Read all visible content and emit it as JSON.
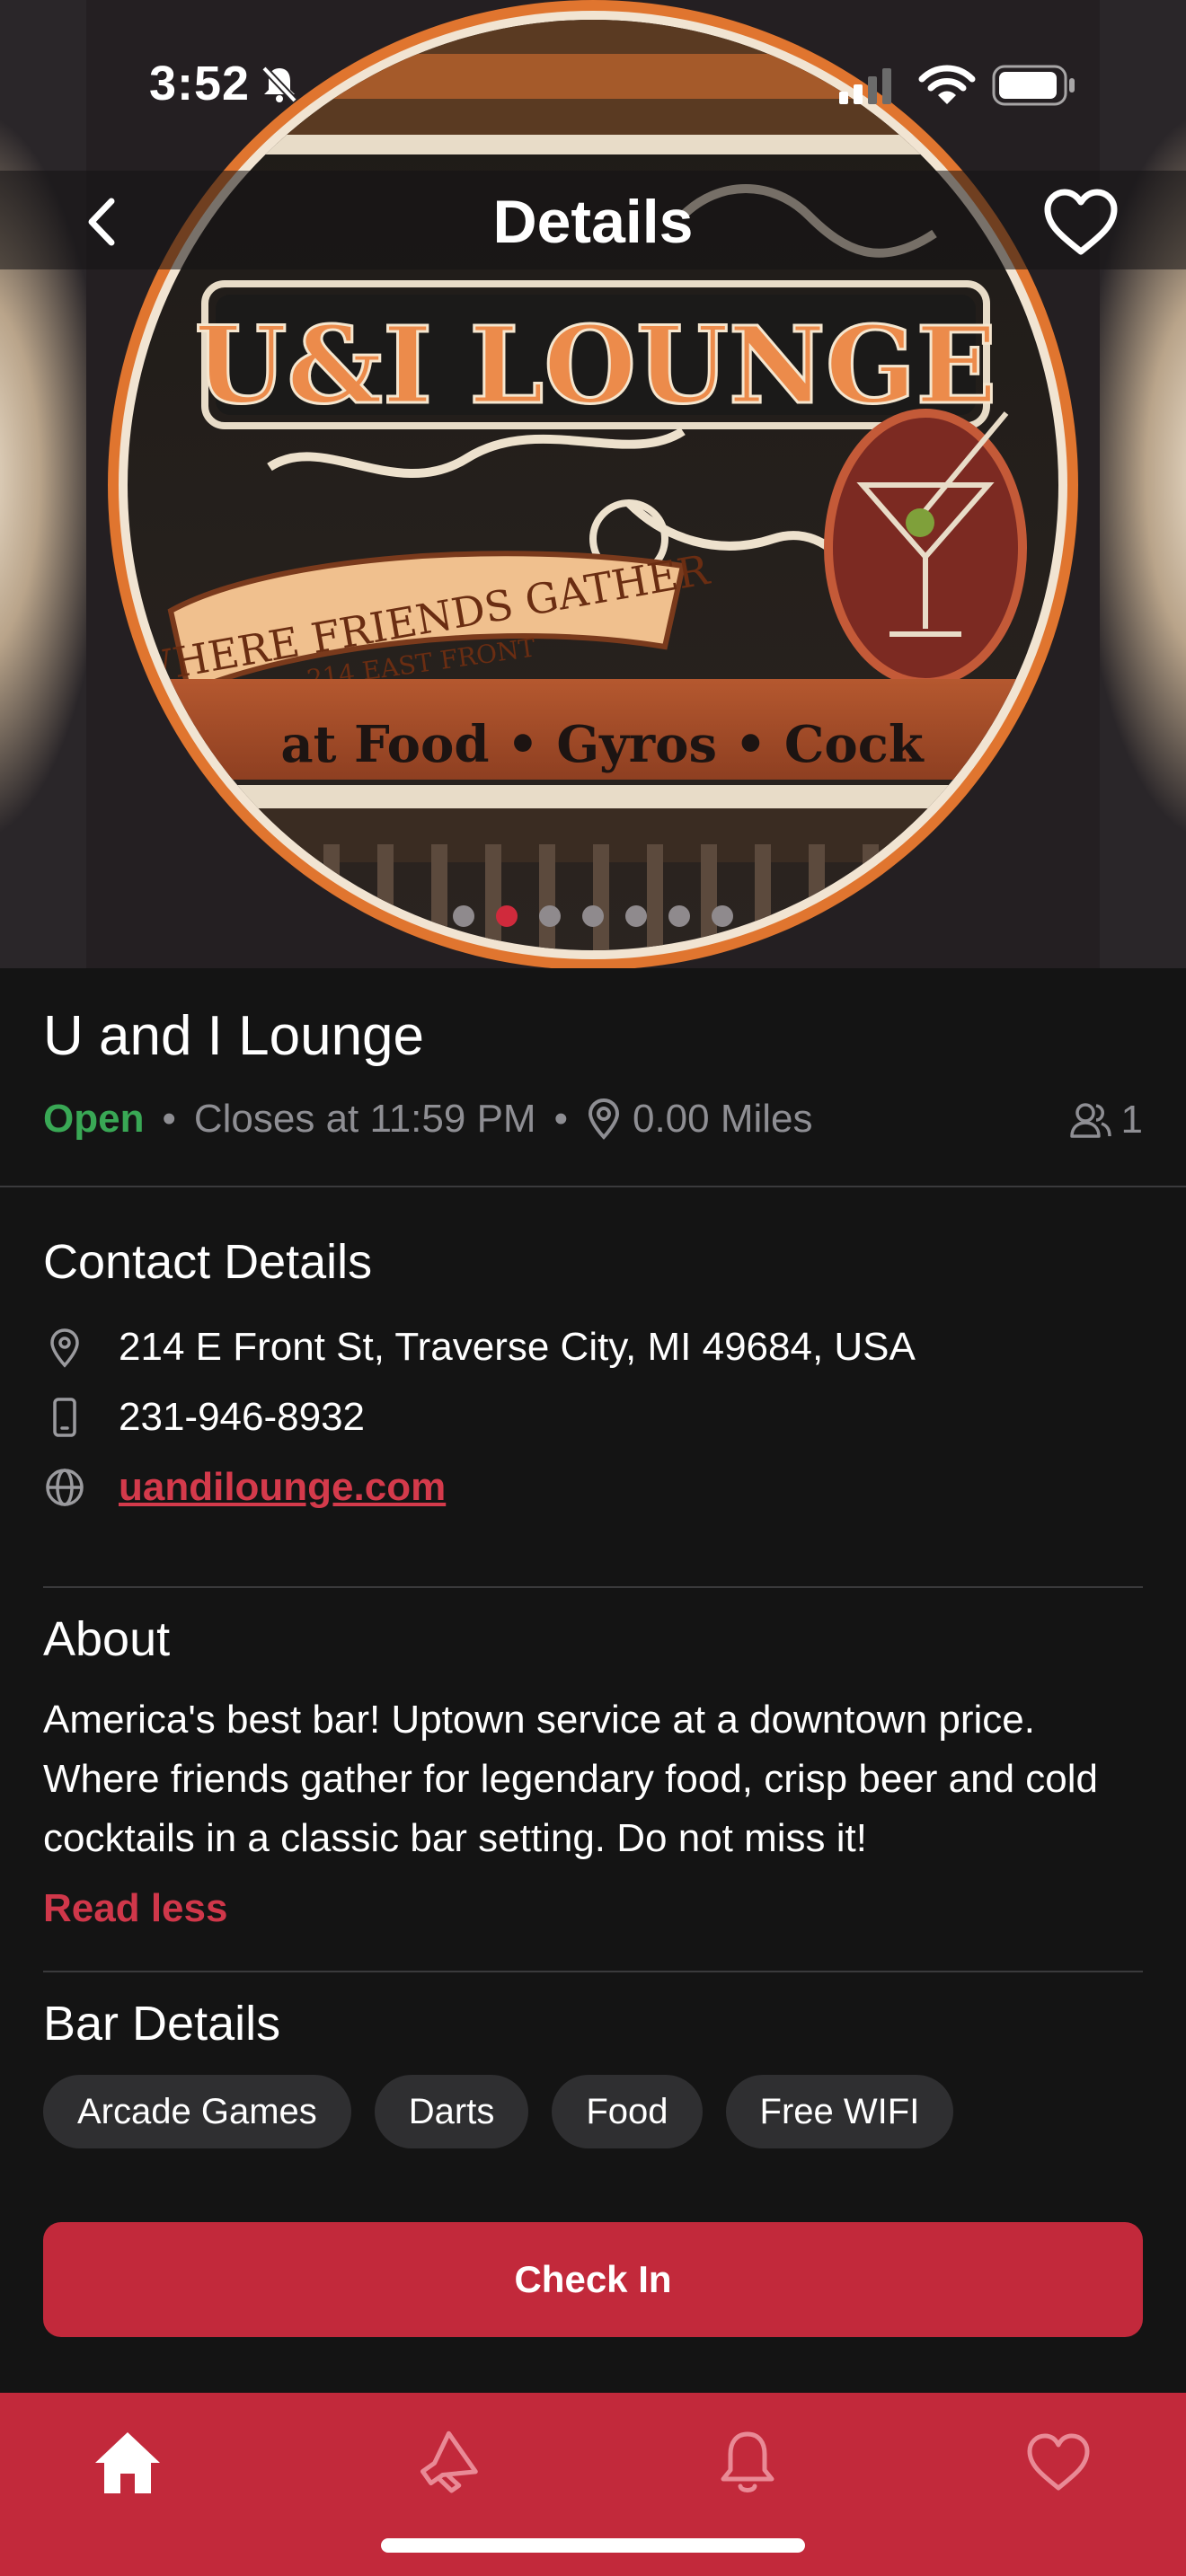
{
  "status_bar": {
    "time": "3:52",
    "icons": [
      "bell-slash-icon",
      "cellular-signal-icon",
      "wifi-icon",
      "battery-icon"
    ]
  },
  "header": {
    "title": "Details",
    "back_icon": "chevron-left-icon",
    "favorite_icon": "heart-outline-icon"
  },
  "hero": {
    "sign_text": {
      "logo": "U&I LOUNGE",
      "banner": "WHERE FRIENDS GATHER",
      "address": "214 EAST FRONT",
      "menu_strip": "at Food • Gyros • Cock"
    },
    "carousel": {
      "total": 7,
      "active_index": 1
    }
  },
  "venue": {
    "name": "U and I Lounge",
    "status": "Open",
    "closes": "Closes at 11:59 PM",
    "distance": "0.00 Miles",
    "checkins": "1",
    "separator": "•"
  },
  "contact": {
    "title": "Contact Details",
    "address": "214 E Front St, Traverse City, MI 49684, USA",
    "phone": "231-946-8932",
    "website": "uandilounge.com"
  },
  "about": {
    "title": "About",
    "text": "America's best bar! Uptown service at a downtown price. Where friends gather for legendary food, crisp beer and cold cocktails in a classic bar setting.  Do not miss it!",
    "toggle_label": "Read less"
  },
  "bar_details": {
    "title": "Bar Details",
    "tags": [
      "Arcade Games",
      "Darts",
      "Food",
      "Free WIFI"
    ]
  },
  "action": {
    "check_in_label": "Check In"
  },
  "tab_bar": {
    "tabs": [
      "home-icon",
      "megaphone-icon",
      "bell-icon",
      "heart-icon"
    ],
    "active": "home-icon"
  },
  "colors": {
    "accent": "#c2293b",
    "open_green": "#39a855",
    "link_red": "#d43a4b",
    "background": "#141414",
    "muted_text": "#8e8e93"
  }
}
